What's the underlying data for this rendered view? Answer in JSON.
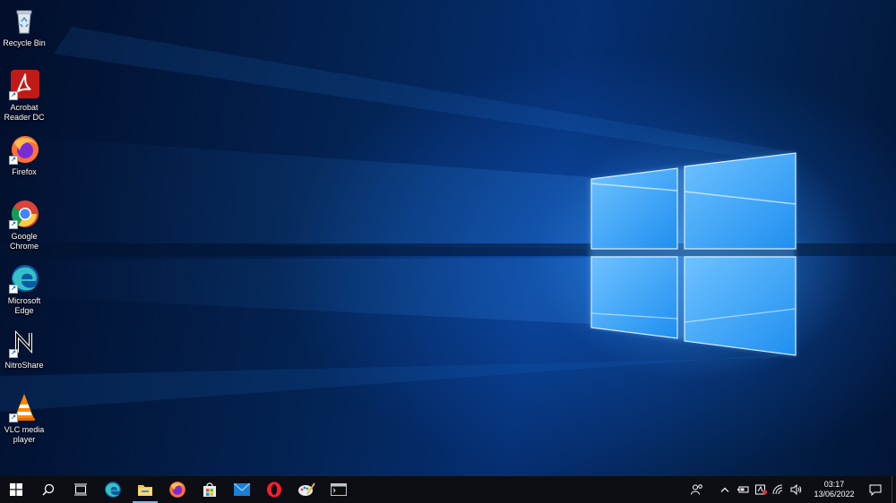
{
  "desktop": {
    "icons": [
      {
        "label": "Recycle Bin",
        "icon": "recycle-bin-icon",
        "shortcut": false
      },
      {
        "label": "Acrobat Reader DC",
        "icon": "acrobat-icon",
        "shortcut": true
      },
      {
        "label": "Firefox",
        "icon": "firefox-icon",
        "shortcut": true
      },
      {
        "label": "Google Chrome",
        "icon": "chrome-icon",
        "shortcut": true
      },
      {
        "label": "Microsoft Edge",
        "icon": "edge-icon",
        "shortcut": true
      },
      {
        "label": "NitroShare",
        "icon": "nitroshare-icon",
        "shortcut": true
      },
      {
        "label": "VLC media player",
        "icon": "vlc-icon",
        "shortcut": true
      }
    ]
  },
  "taskbar": {
    "start": "windows-start-icon",
    "search": "search-icon",
    "task_view": "task-view-icon",
    "pinned": [
      {
        "name": "Microsoft Edge",
        "icon": "edge-icon"
      },
      {
        "name": "File Explorer",
        "icon": "file-explorer-icon",
        "active": true
      },
      {
        "name": "Firefox",
        "icon": "firefox-icon"
      },
      {
        "name": "Microsoft Store",
        "icon": "store-icon"
      },
      {
        "name": "Mail",
        "icon": "mail-icon"
      },
      {
        "name": "Opera",
        "icon": "opera-icon"
      },
      {
        "name": "Paint",
        "icon": "paint-icon"
      },
      {
        "name": "Command Prompt",
        "icon": "terminal-icon"
      }
    ],
    "tray": {
      "time": "03:17",
      "date": "13/06/2022",
      "icons": [
        "people-icon",
        "chevron-up-icon",
        "battery-icon",
        "security-icon",
        "wifi-icon",
        "volume-icon",
        "notification-icon"
      ]
    }
  },
  "colors": {
    "taskbar_bg": "#0c0e14",
    "accent": "#76b9ed"
  }
}
